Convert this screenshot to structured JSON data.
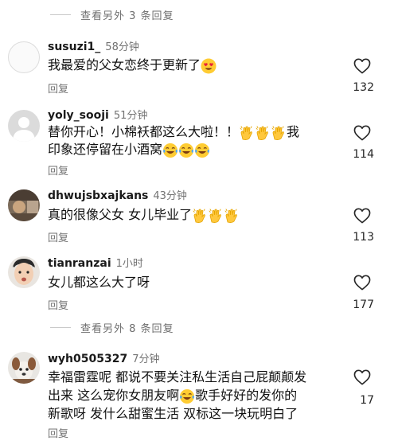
{
  "more_replies_top": {
    "label": "查看另外 3 条回复"
  },
  "more_replies_mid": {
    "label": "查看另外 8 条回复"
  },
  "comments": [
    {
      "username": "susuzi1_",
      "time": "58分钟",
      "text_parts": [
        "我最爱的父女恋终于更新了"
      ],
      "reply_label": "回复",
      "likes": "132"
    },
    {
      "username": "yoly_sooji",
      "time": "51分钟",
      "line1": "替你开心！小棉袄都这么大啦！！",
      "line1_end": "我",
      "line2": "印象还停留在小酒窝",
      "reply_label": "回复",
      "likes": "114"
    },
    {
      "username": "dhwujsbxajkans",
      "time": "43分钟",
      "text": "真的很像父女 女儿毕业了",
      "reply_label": "回复",
      "likes": "113"
    },
    {
      "username": "tianranzai",
      "time": "1小时",
      "text": "女儿都这么大了呀",
      "reply_label": "回复",
      "likes": "177"
    },
    {
      "username": "wyh0505327",
      "time": "7分钟",
      "line1": "幸福雷霆呢 都说不要关注私生活自己屁颠颠发",
      "line2_a": "出来 这么宠你女朋友啊",
      "line2_b": "歌手好好的发你的",
      "line3": "新歌呀 发什么甜蜜生活 双标这一块玩明白了",
      "reply_label": "回复",
      "likes": "17"
    }
  ],
  "icons": {
    "like": "heart-outline-icon",
    "emoji_heart_eyes": "heart-eyes-emoji",
    "emoji_clap": "clapping-hands-emoji",
    "emoji_laugh": "tears-of-joy-emoji"
  }
}
